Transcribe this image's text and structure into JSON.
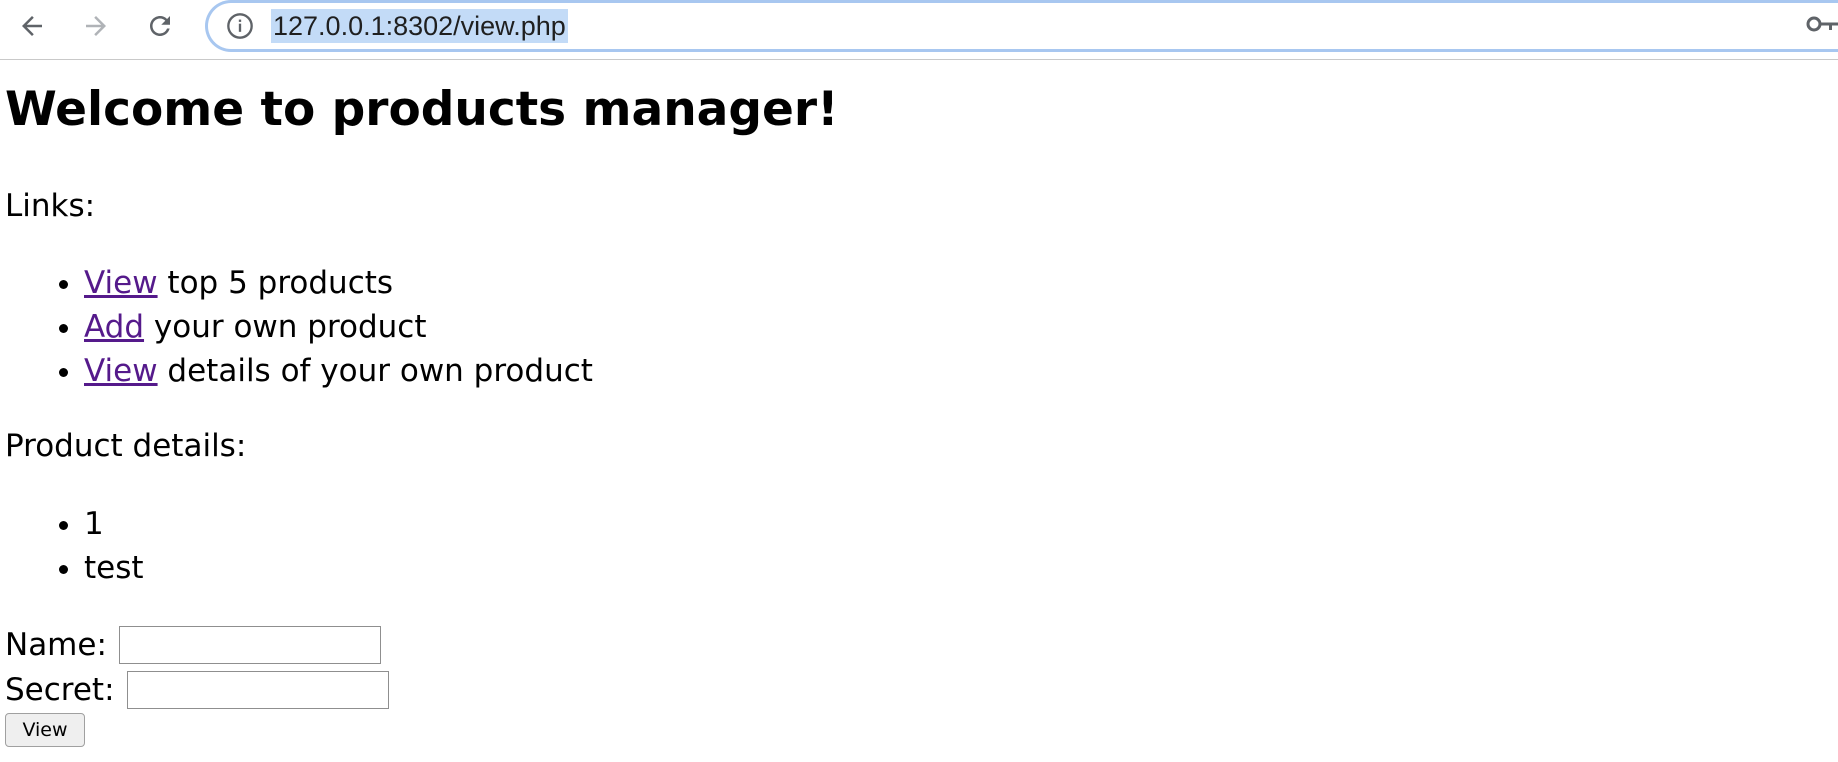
{
  "browser": {
    "url": "127.0.0.1:8302/view.php",
    "icons": [
      "back-arrow-icon",
      "forward-arrow-icon",
      "reload-icon",
      "info-icon",
      "key-icon"
    ]
  },
  "page": {
    "title": "Welcome to products manager!",
    "links_heading": "Links:",
    "links": [
      {
        "link_text": "View",
        "rest": " top 5 products"
      },
      {
        "link_text": "Add",
        "rest": " your own product"
      },
      {
        "link_text": "View",
        "rest": " details of your own product"
      }
    ],
    "details_heading": "Product details:",
    "details": [
      "1",
      "test"
    ],
    "form": {
      "name_label": "Name:",
      "name_value": "",
      "secret_label": "Secret:",
      "secret_value": "",
      "submit_label": "View"
    }
  },
  "colors": {
    "link": "#551a8b",
    "url_highlight": "#c3dbf7",
    "address_border": "#a8c7f0"
  }
}
